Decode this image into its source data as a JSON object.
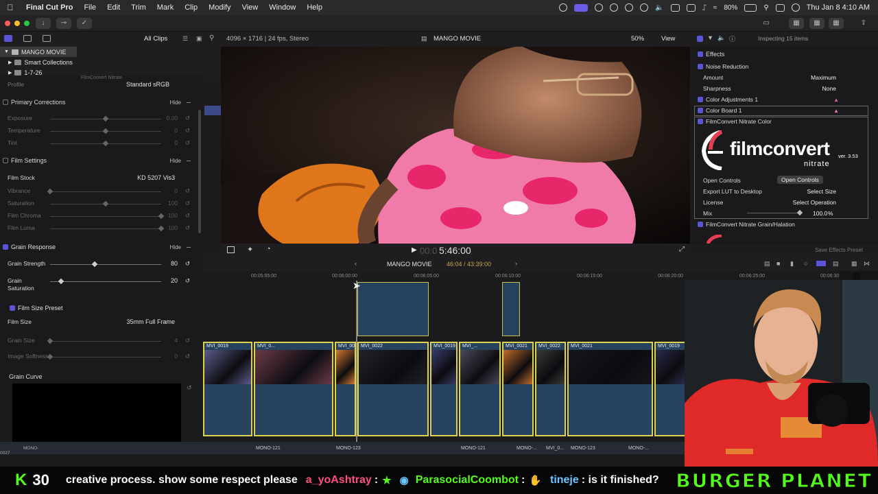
{
  "menubar": {
    "app": "Final Cut Pro",
    "items": [
      "File",
      "Edit",
      "Trim",
      "Mark",
      "Clip",
      "Modify",
      "View",
      "Window",
      "Help"
    ],
    "battery": "80%",
    "clock": "Thu Jan 8  4:10 AM"
  },
  "browser": {
    "filter": "All Clips",
    "library": "MANGO MOVIE",
    "rows": [
      "Smart Collections",
      "1-7-26"
    ]
  },
  "plugin": {
    "title": "FilmConvert Nitrate",
    "profile_label": "Profile",
    "profile_value": "Standard sRGB",
    "hide_label": "Hide",
    "sections": {
      "primary": "Primary Corrections",
      "film_settings": "Film Settings",
      "grain_response": "Grain Response",
      "film_size_preset": "Film Size Preset",
      "grain_curve": "Grain Curve"
    },
    "primary_rows": [
      {
        "label": "Exposure",
        "value": "0.00",
        "knob_pct": 50
      },
      {
        "label": "Temperature",
        "value": "0",
        "knob_pct": 50
      },
      {
        "label": "Tint",
        "value": "0",
        "knob_pct": 50
      }
    ],
    "film_stock_label": "Film Stock",
    "film_stock_value": "KD 5207 Vis3",
    "film_rows": [
      {
        "label": "Vibrance",
        "value": "0",
        "knob_pct": 0
      },
      {
        "label": "Saturation",
        "value": "100",
        "knob_pct": 50
      },
      {
        "label": "Film Chroma",
        "value": "100",
        "knob_pct": 100
      },
      {
        "label": "Film Luma",
        "value": "100",
        "knob_pct": 100
      }
    ],
    "grain_rows": [
      {
        "label": "Grain Strength",
        "value": "80",
        "knob_pct": 40
      },
      {
        "label": "Grain Saturation",
        "value": "20",
        "knob_pct": 10
      }
    ],
    "film_size_label": "Film Size",
    "film_size_value": "35mm Full Frame",
    "size_rows": [
      {
        "label": "Grain Size",
        "value": "4",
        "knob_pct": 0
      },
      {
        "label": "Image Softness",
        "value": "0",
        "knob_pct": 0
      }
    ]
  },
  "viewer": {
    "format": "4096 × 1716 | 24 fps, Stereo",
    "title": "MANGO MOVIE",
    "zoom": "50%",
    "view": "View",
    "timecode": "5:46:00",
    "timecode_prefix": "00:0"
  },
  "inspector": {
    "status": "Inspecting 15 items",
    "effects_label": "Effects",
    "noise_reduction": "Noise Reduction",
    "amount_label": "Amount",
    "amount_value": "Maximum",
    "sharpness_label": "Sharpness",
    "sharpness_value": "None",
    "color_adjustments": "Color Adjustments 1",
    "color_board": "Color Board 1",
    "fc_color": "FilmConvert Nitrate Color",
    "logo_main": "filmconvert",
    "logo_sub": "nitrate",
    "version": "ver. 3.53",
    "open_controls_label": "Open Controls",
    "open_controls_button": "Open Controls",
    "export_lut_label": "Export LUT to Desktop",
    "export_lut_value": "Select Size",
    "license_label": "License",
    "license_value": "Select Operation",
    "mix_label": "Mix",
    "mix_value": "100.0",
    "mix_unit": "%",
    "fc_grain": "FilmConvert Nitrate Grain/Halation",
    "save_preset": "Save Effects Preset"
  },
  "timeline": {
    "project": "MANGO MOVIE",
    "duration": "46:04 / 43:39:00",
    "ruler": [
      "00:05:55:00",
      "00:06:00:00",
      "00:06:05:00",
      "00:06:10:00",
      "00:06:15:00",
      "00:06:20:00",
      "00:06:25:00",
      "00:06:30:"
    ],
    "clips": [
      "MVI_0019",
      "MVI_0...",
      "MVI_0021",
      "MVI_0022",
      "MVI_0019",
      "MVI_...",
      "MVI_0021",
      "MVI_0022",
      "MVI_0021",
      "MVI_0019"
    ],
    "audio": [
      "MONO-0027",
      "MONO-121",
      "MONO-123",
      "MONO-121",
      "MONO-...",
      "MVI_0...",
      "MONO-123",
      "MONO-..."
    ]
  },
  "chat": {
    "count": "30",
    "k": "K",
    "message1": "creative process. show some respect please",
    "user1": "a_yoAshtray",
    "user1_sep": ":",
    "user2": "ParasocialCoombot",
    "user2_sep": ":",
    "user3": "tineje",
    "message3": ": is it finished?",
    "brand": "BURGER PLANET"
  }
}
